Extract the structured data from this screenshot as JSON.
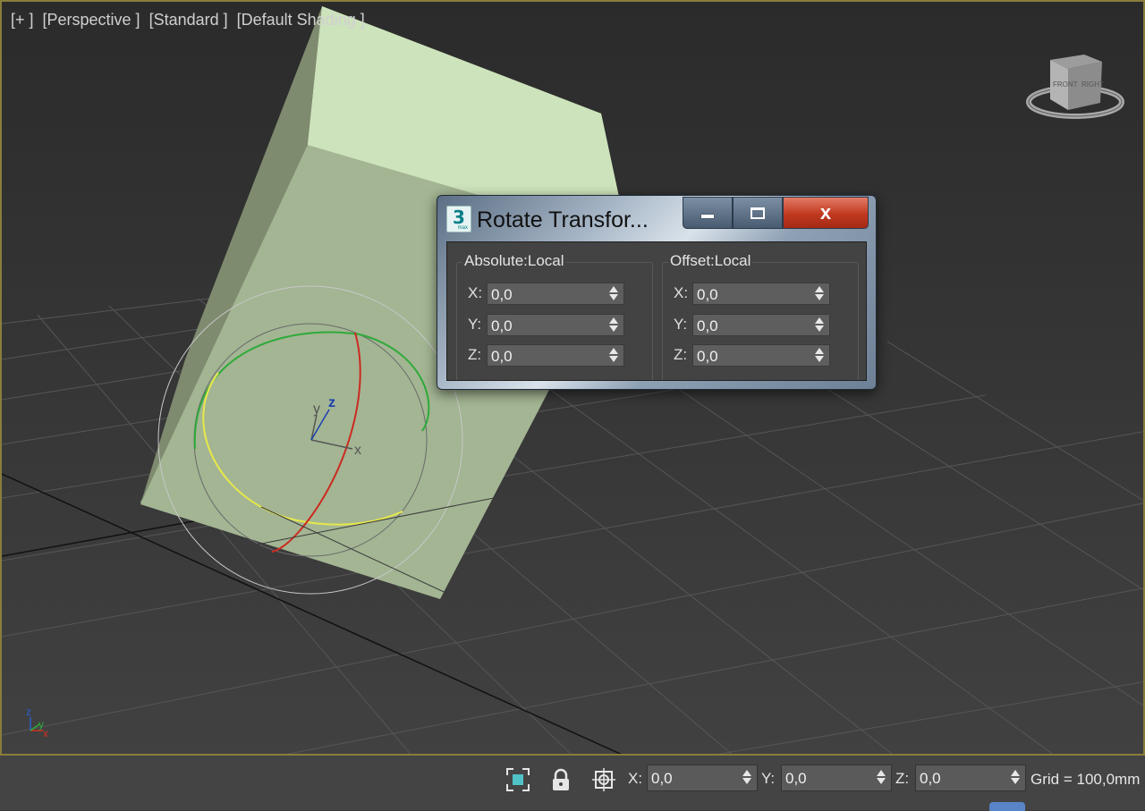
{
  "viewport": {
    "labels": [
      "[+ ]",
      "[Perspective ]",
      "[Standard ]",
      "[Default Shading ]"
    ],
    "viewcube": {
      "front": "FRONT",
      "right": "RIGHT"
    },
    "gizmo_axes": {
      "x": "x",
      "y": "y",
      "z": "z"
    },
    "corner_axes": {
      "x": "x",
      "y": "y",
      "z": "z"
    },
    "colors": {
      "box_light": "#cde3bc",
      "box_mid": "#a3b593",
      "box_dark": "#7f8b6f",
      "grid": "#575757"
    }
  },
  "dialog": {
    "app_icon": {
      "glyph": "3",
      "sub": "max"
    },
    "title": "Rotate Transfor...",
    "minimize_icon": "minimize-icon",
    "maximize_icon": "maximize-icon",
    "close_label": "x",
    "absolute": {
      "title": "Absolute:Local",
      "x_label": "X:",
      "x": "0,0",
      "y_label": "Y:",
      "y": "0,0",
      "z_label": "Z:",
      "z": "0,0"
    },
    "offset": {
      "title": "Offset:Local",
      "x_label": "X:",
      "x": "0,0",
      "y_label": "Y:",
      "y": "0,0",
      "z_label": "Z:",
      "z": "0,0"
    }
  },
  "statusbar": {
    "x_label": "X:",
    "x": "0,0",
    "y_label": "Y:",
    "y": "0,0",
    "z_label": "Z:",
    "z": "0,0",
    "grid": "Grid = 100,0mm",
    "accent": "#4fc3c8"
  }
}
